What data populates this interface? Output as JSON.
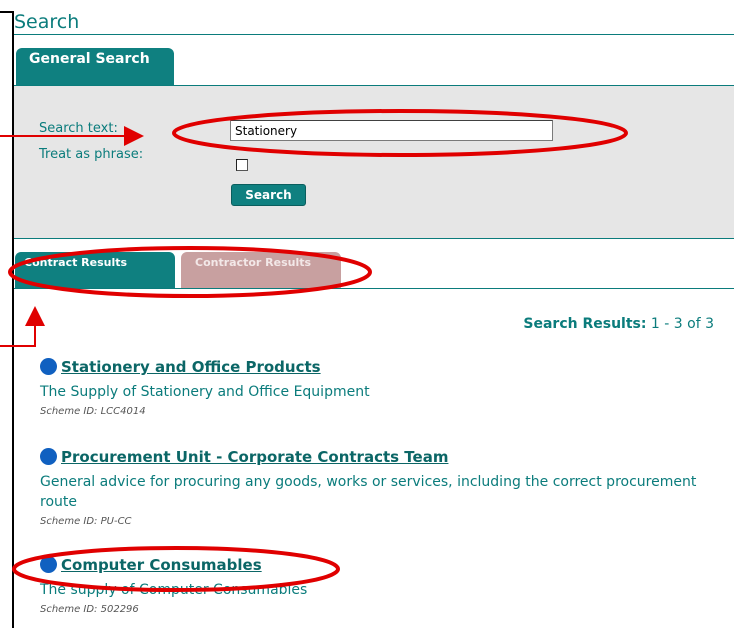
{
  "page": {
    "title": "Search"
  },
  "general_tab": {
    "label": "General Search"
  },
  "form": {
    "search_label": "Search text:",
    "search_value": "Stationery",
    "phrase_label": "Treat as phrase:",
    "phrase_checked": false,
    "search_button": "Search"
  },
  "result_tabs": [
    {
      "label": "Contract Results",
      "active": true
    },
    {
      "label": "Contractor Results",
      "active": false
    }
  ],
  "summary": {
    "label": "Search Results:",
    "range": "1 - 3 of 3"
  },
  "results": [
    {
      "title": "Stationery and Office Products",
      "description": "The Supply of Stationery and Office Equipment",
      "meta": "Scheme ID: LCC4014"
    },
    {
      "title": "Procurement Unit - Corporate Contracts Team",
      "description": "General advice for procuring any goods, works or services, including the correct procurement route",
      "meta": "Scheme ID: PU-CC"
    },
    {
      "title": "Computer Consumables",
      "description": "The supply of Computer Consumables",
      "meta": "Scheme ID: 502296"
    }
  ],
  "colors": {
    "accent": "#0f8080",
    "inactive_tab": "#c8a0a0",
    "annotation": "#e00000",
    "bullet": "#1060c0"
  }
}
